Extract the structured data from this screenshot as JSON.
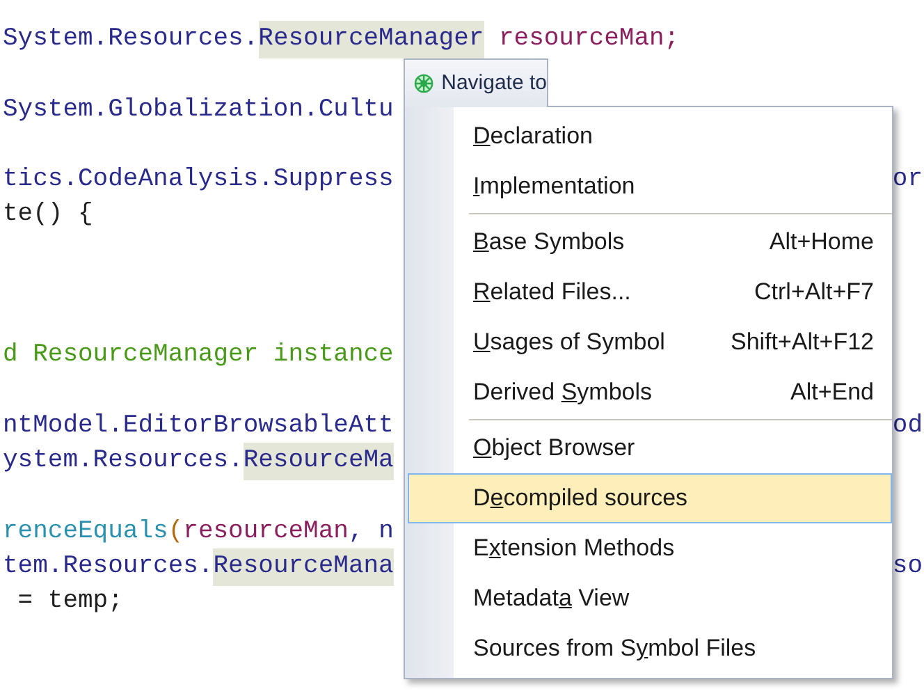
{
  "code_lines": [
    {
      "kind": "code",
      "segments": [
        {
          "text": "System.Resources.",
          "kind": "type"
        },
        {
          "text": "ResourceManager",
          "kind": "highlight"
        },
        {
          "text": " resourceMan;",
          "kind": "field"
        }
      ]
    },
    {
      "kind": "blank"
    },
    {
      "kind": "code",
      "segments": [
        {
          "text": "System.Globalization.Cultu",
          "kind": "type"
        }
      ]
    },
    {
      "kind": "blank"
    },
    {
      "kind": "code",
      "segments": [
        {
          "text": "tics.CodeAnalysis.Suppress",
          "kind": "type"
        }
      ],
      "tail": "or"
    },
    {
      "kind": "code",
      "segments": [
        {
          "text": "te() {",
          "kind": "plain"
        }
      ]
    },
    {
      "kind": "blank"
    },
    {
      "kind": "blank"
    },
    {
      "kind": "blank"
    },
    {
      "kind": "code",
      "segments": [
        {
          "text": "d ResourceManager instance",
          "kind": "comment"
        }
      ]
    },
    {
      "kind": "blank"
    },
    {
      "kind": "code",
      "segments": [
        {
          "text": "ntModel.EditorBrowsableAtt",
          "kind": "type"
        }
      ],
      "tail": "od"
    },
    {
      "kind": "code",
      "segments": [
        {
          "text": "ystem.Resources.",
          "kind": "type"
        },
        {
          "text": "ResourceMa",
          "kind": "highlight"
        }
      ]
    },
    {
      "kind": "blank"
    },
    {
      "kind": "code",
      "segments": [
        {
          "text": "renceEquals",
          "kind": "method"
        },
        {
          "text": "(",
          "kind": "paren"
        },
        {
          "text": "resourceMan",
          "kind": "field"
        },
        {
          "text": ", n",
          "kind": "type"
        }
      ]
    },
    {
      "kind": "code",
      "segments": [
        {
          "text": "tem.Resources.",
          "kind": "type"
        },
        {
          "text": "ResourceMana",
          "kind": "highlight"
        }
      ],
      "tail": "so"
    },
    {
      "kind": "code",
      "segments": [
        {
          "text": " = temp;",
          "kind": "plain"
        }
      ]
    }
  ],
  "menu": {
    "title": "Navigate to",
    "groups": [
      [
        {
          "mnemonic": "D",
          "after": "eclaration",
          "selected": false
        },
        {
          "mnemonic": "I",
          "after": "mplementation",
          "selected": false
        }
      ],
      [
        {
          "mnemonic": "B",
          "after": "ase Symbols",
          "shortcut": "Alt+Home",
          "selected": false
        },
        {
          "mnemonic": "R",
          "after": "elated Files...",
          "shortcut": "Ctrl+Alt+F7",
          "selected": false
        },
        {
          "mnemonic": "U",
          "after": "sages of Symbol",
          "shortcut": "Shift+Alt+F12",
          "selected": false
        },
        {
          "before": "Derived ",
          "mnemonic": "S",
          "after": "ymbols",
          "shortcut": "Alt+End",
          "selected": false
        }
      ],
      [
        {
          "mnemonic": "O",
          "after": "bject Browser",
          "selected": false
        },
        {
          "before": "D",
          "mnemonic": "e",
          "after": "compiled sources",
          "selected": true
        },
        {
          "before": "E",
          "mnemonic": "x",
          "after": "tension Methods",
          "selected": false
        },
        {
          "before": "Metadat",
          "mnemonic": "a",
          "after": " View",
          "selected": false
        },
        {
          "before": "Sources from S",
          "mnemonic": "y",
          "after": "mbol Files",
          "selected": false
        }
      ]
    ]
  }
}
